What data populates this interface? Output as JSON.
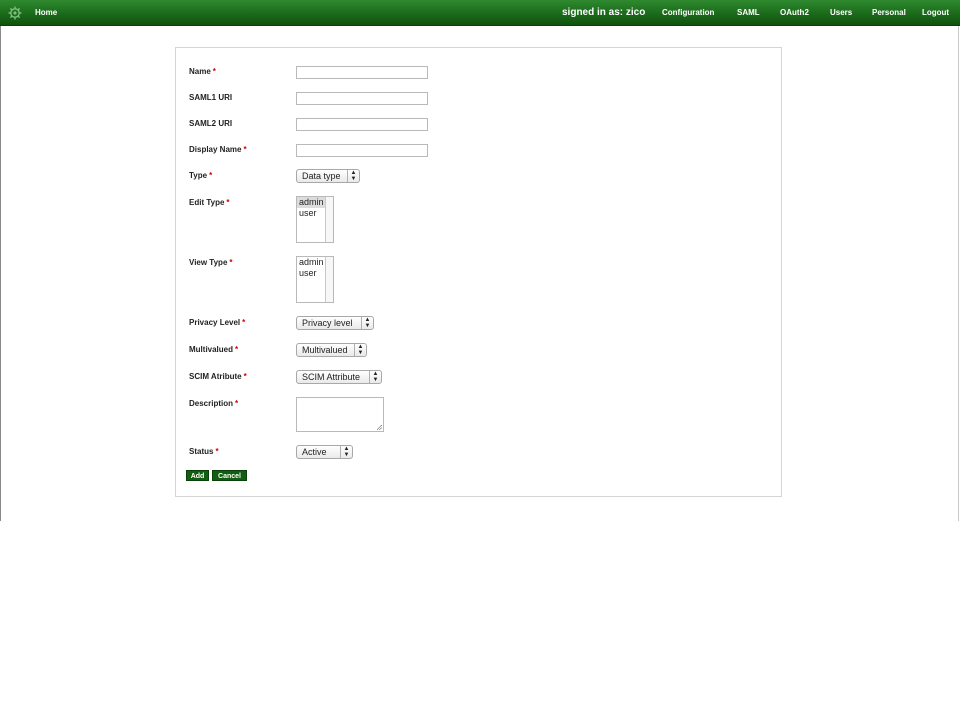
{
  "nav": {
    "home": "Home",
    "signed_in": "signed in as: zico",
    "items": [
      "Configuration",
      "SAML",
      "OAuth2",
      "Users",
      "Personal",
      "Logout"
    ]
  },
  "form": {
    "required_mark": "*",
    "name": {
      "label": "Name",
      "value": ""
    },
    "saml1_uri": {
      "label": "SAML1 URI",
      "value": ""
    },
    "saml2_uri": {
      "label": "SAML2 URI",
      "value": ""
    },
    "display_name": {
      "label": "Display Name",
      "value": ""
    },
    "type": {
      "label": "Type",
      "selected": "Data type"
    },
    "edit_type": {
      "label": "Edit Type",
      "options": [
        "admin",
        "user"
      ]
    },
    "view_type": {
      "label": "View Type",
      "options": [
        "admin",
        "user"
      ]
    },
    "privacy_level": {
      "label": "Privacy Level",
      "selected": "Privacy level"
    },
    "multivalued": {
      "label": "Multivalued",
      "selected": "Multivalued"
    },
    "scim_attribute": {
      "label": "SCIM Atribute",
      "selected": "SCIM Attribute"
    },
    "description": {
      "label": "Description",
      "value": ""
    },
    "status": {
      "label": "Status",
      "selected": "Active"
    },
    "add_button": "Add",
    "cancel_button": "Cancel"
  },
  "colors": {
    "topbar": "#1b6a1b",
    "button": "#115e11",
    "required": "#d00000"
  },
  "icons": {
    "logo": "gear-icon",
    "select_arrows": "updown-arrow-icon"
  }
}
